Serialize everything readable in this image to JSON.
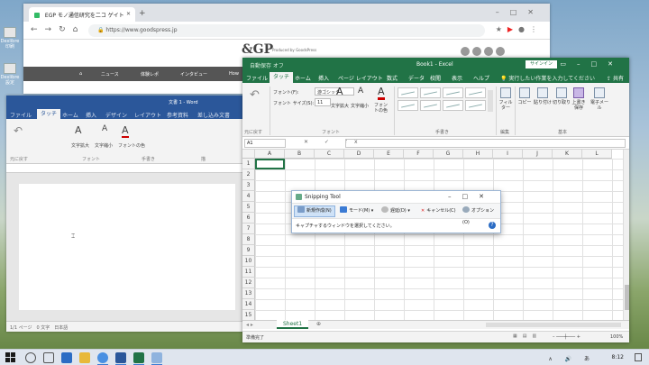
{
  "desktop": {
    "icons": [
      "Dexlibre\n印刷",
      "Dexlibre\n設定"
    ]
  },
  "browser": {
    "tab_title": "EGP モノ通信研究を二コ ゲイト",
    "url": "https://www.goodspress.jp",
    "site_logo": "&GP",
    "site_tagline": "Produced by GoodsPress",
    "nav": [
      "ニュース",
      "体験レポ",
      "インタビュー",
      "How"
    ]
  },
  "word": {
    "title": "文書 1 - Word",
    "tabs": [
      "ファイル",
      "タッチ",
      "ホーム",
      "挿入",
      "デザイン",
      "レイアウト",
      "参考資料",
      "差し込み文書"
    ],
    "ribbon_buttons": [
      "元に戻す",
      "文字拡大",
      "文字縮小",
      "フォントの色"
    ],
    "groups": [
      "元に戻す",
      "フォント",
      "手書き",
      "描"
    ],
    "status": "1/1 ページ　0 文字　日本語"
  },
  "excel": {
    "qat": "自動保存 オフ",
    "title": "Book1 - Excel",
    "signin": "サインイン",
    "tabs": [
      "ファイル",
      "タッチ",
      "ホーム",
      "挿入",
      "ページ レイアウト",
      "数式",
      "データ",
      "校閲",
      "表示",
      "ヘルプ"
    ],
    "tell_me": "実行したい作業を入力してください",
    "share": "共有",
    "ribbon": {
      "undo": "元に戻す",
      "font_label": "フォント(F):",
      "font_value": "游ゴシック",
      "size_label": "フォント サイズ(S):",
      "size_value": "11",
      "grow": "文字拡大",
      "shrink": "文字縮小",
      "font_color": "フォントの色",
      "filter": "フィルター",
      "copy": "コピー",
      "paste": "貼り付け",
      "cut": "切り取り",
      "save": "上書き保存",
      "email": "電子メール"
    },
    "groups": [
      "元に戻す",
      "フォント",
      "手書き",
      "編集",
      "基本"
    ],
    "name_box": "A1",
    "formula_icons": "✕ ✓ fx",
    "columns": [
      "A",
      "B",
      "C",
      "D",
      "E",
      "F",
      "G",
      "H",
      "I",
      "J",
      "K",
      "L"
    ],
    "rows": [
      "1",
      "2",
      "3",
      "4",
      "5",
      "6",
      "7",
      "8",
      "9",
      "10",
      "11",
      "12",
      "13",
      "14",
      "15",
      "16"
    ],
    "sheet": "Sheet1",
    "status": "準備完了",
    "zoom": "100%"
  },
  "snipping": {
    "title": "Snipping Tool",
    "buttons": [
      "新規作成(N)",
      "モード(M)",
      "遅延(D)",
      "キャンセル(C)",
      "オプション(O)"
    ],
    "message": "キャプチャするウィンドウを選択してください。",
    "help": "?"
  },
  "taskbar": {
    "tray": "∧ 🔊 あ",
    "time": "8:12"
  }
}
